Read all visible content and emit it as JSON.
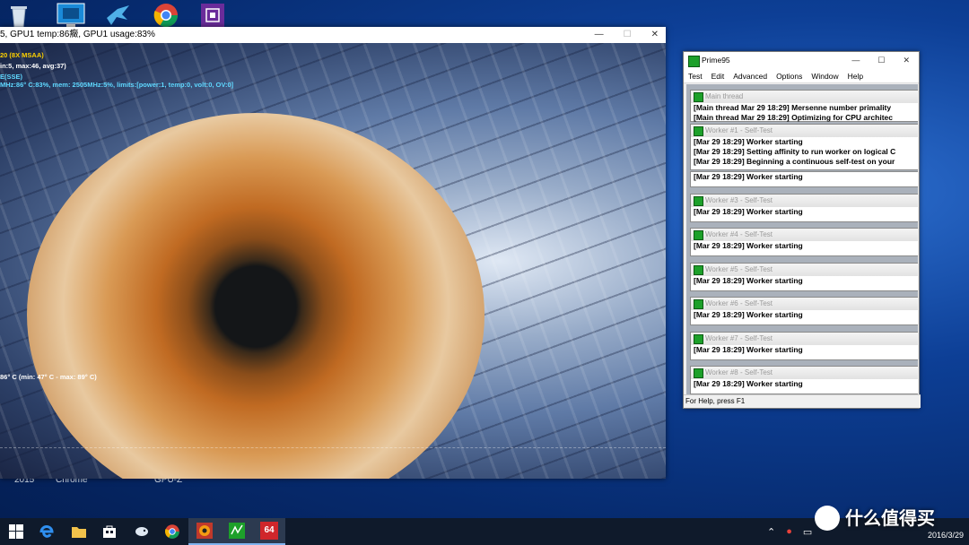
{
  "desktop": {
    "icons": [
      "recycle-bin-icon",
      "cpu-monitor-icon",
      "bird-app-icon",
      "chrome-icon",
      "chip-app-icon"
    ],
    "labels": [
      "2015",
      "Chrome",
      "GPU-Z"
    ]
  },
  "gpu_window": {
    "title": "5, GPU1 temp:86癥, GPU1 usage:83%",
    "osd": {
      "line1": "20 (8X MSAA)",
      "line2": "in:5, max:46, avg:37)",
      "line3": "E(SSE)",
      "line4": "MHz:86° C:83%, mem: 2505MHz:5%, limits:[power:1, temp:0, volt:0, OV:0]",
      "temp": "86° C (min: 47° C - max: 89° C)"
    }
  },
  "prime95": {
    "title": "Prime95",
    "menu": [
      "Test",
      "Edit",
      "Advanced",
      "Options",
      "Window",
      "Help"
    ],
    "main_thread": {
      "header": "Main thread",
      "lines": [
        "[Main thread Mar 29 18:29] Mersenne number primality",
        "[Main thread Mar 29 18:29] Optimizing for CPU architec"
      ]
    },
    "worker1": {
      "header": "Worker #1 - Self-Test",
      "lines": [
        "[Mar 29 18:29] Worker starting",
        "[Mar 29 18:29] Setting affinity to run worker on logical C",
        "[Mar 29 18:29] Beginning a continuous self-test on your"
      ]
    },
    "worker2": {
      "lines": [
        "[Mar 29 18:29] Worker starting"
      ]
    },
    "worker3": {
      "header": "Worker #3 - Self-Test",
      "lines": [
        "[Mar 29 18:29] Worker starting"
      ]
    },
    "worker4": {
      "header": "Worker #4 - Self-Test",
      "lines": [
        "[Mar 29 18:29] Worker starting"
      ]
    },
    "worker5": {
      "header": "Worker #5 - Self-Test",
      "lines": [
        "[Mar 29 18:29] Worker starting"
      ]
    },
    "worker6": {
      "header": "Worker #6 - Self-Test",
      "lines": [
        "[Mar 29 18:29] Worker starting"
      ]
    },
    "worker7": {
      "header": "Worker #7 - Self-Test",
      "lines": [
        "[Mar 29 18:29] Worker starting"
      ]
    },
    "worker8": {
      "header": "Worker #8 - Self-Test",
      "lines": [
        "[Mar 29 18:29] Worker starting"
      ]
    },
    "status": "For Help, press F1"
  },
  "taskbar": {
    "items": [
      "windows-start-icon",
      "edge-icon",
      "file-explorer-icon",
      "store-icon",
      "bird-app-icon",
      "chrome-icon",
      "furmark-icon",
      "prime95-icon",
      "aida64-icon"
    ],
    "aida_label": "64",
    "date": "2016/3/29",
    "watermark": "什么值得买"
  },
  "colors": {
    "desktop_bg": "#0d3f96",
    "osd_yellow": "#ffd200",
    "osd_cyan": "#5fd8ff",
    "prime95_green": "#1da02a",
    "taskbar": "#0f1a2b"
  }
}
